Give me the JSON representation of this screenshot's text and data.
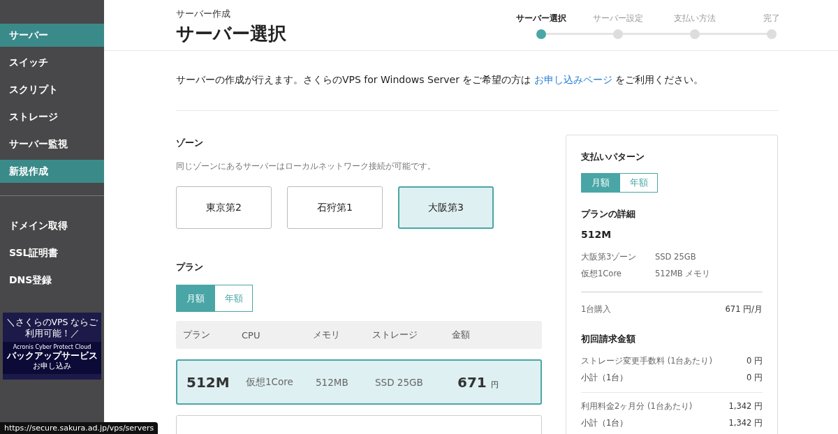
{
  "sidebar": {
    "groups": [
      {
        "items": [
          {
            "label": "サーバー",
            "selected": true
          },
          {
            "label": "スイッチ",
            "selected": false
          },
          {
            "label": "スクリプト",
            "selected": false
          },
          {
            "label": "ストレージ",
            "selected": false
          },
          {
            "label": "サーバー監視",
            "selected": false
          },
          {
            "label": "新規作成",
            "selected": true
          }
        ]
      },
      {
        "items": [
          {
            "label": "ドメイン取得",
            "selected": false
          },
          {
            "label": "SSL証明書",
            "selected": false
          },
          {
            "label": "DNS登録",
            "selected": false
          }
        ]
      }
    ],
    "banner": {
      "tagline": "＼さくらのVPS ならご利用可能！／",
      "product": "Acronis Cyber Protect Cloud",
      "title": "バックアップサービス",
      "cta": "お申し込み"
    }
  },
  "status_url": "https://secure.sakura.ad.jp/vps/servers",
  "header": {
    "breadcrumb": "サーバー作成",
    "title": "サーバー選択",
    "steps": [
      {
        "label": "サーバー選択",
        "selected": true
      },
      {
        "label": "サーバー設定",
        "selected": false
      },
      {
        "label": "支払い方法",
        "selected": false
      },
      {
        "label": "完了",
        "selected": false
      }
    ]
  },
  "intro": {
    "before": "サーバーの作成が行えます。さくらのVPS for Windows Server をご希望の方は",
    "link": "お申し込みページ",
    "after": "をご利用ください。"
  },
  "zone": {
    "heading": "ゾーン",
    "note": "同じゾーンにあるサーバーはローカルネットワーク接続が可能です。",
    "options": [
      {
        "label": "東京第2",
        "selected": false
      },
      {
        "label": "石狩第1",
        "selected": false
      },
      {
        "label": "大阪第3",
        "selected": true
      }
    ]
  },
  "plan": {
    "heading": "プラン",
    "billing": [
      {
        "label": "月額",
        "selected": true
      },
      {
        "label": "年額",
        "selected": false
      }
    ],
    "columns": [
      "プラン",
      "CPU",
      "メモリ",
      "ストレージ",
      "金額"
    ],
    "rows": [
      {
        "name": "512M",
        "cpu": "仮想1Core",
        "memory": "512MB",
        "storage": "SSD 25GB",
        "price": "671",
        "unit": "円",
        "selected": true
      },
      {
        "selected": false
      }
    ]
  },
  "summary": {
    "payment_heading": "支払いパターン",
    "billing": [
      {
        "label": "月額",
        "selected": true
      },
      {
        "label": "年額",
        "selected": false
      }
    ],
    "details_heading": "プランの詳細",
    "plan_name": "512M",
    "specs": [
      [
        "大阪第3ゾーン",
        "SSD 25GB"
      ],
      [
        "仮想1Core",
        "512MB メモリ"
      ]
    ],
    "purchase": {
      "label": "1台購入",
      "value": "671 円/月"
    },
    "initial_heading": "初回請求金額",
    "line_groups": [
      [
        {
          "label": "ストレージ変更手数料 (1台あたり)",
          "value": "0 円"
        },
        {
          "label": "小計（1台）",
          "value": "0 円"
        }
      ],
      [
        {
          "label": "利用料金2ヶ月分 (1台あたり)",
          "value": "1,342 円"
        },
        {
          "label": "小計（1台）",
          "value": "1,342 円"
        }
      ]
    ]
  }
}
